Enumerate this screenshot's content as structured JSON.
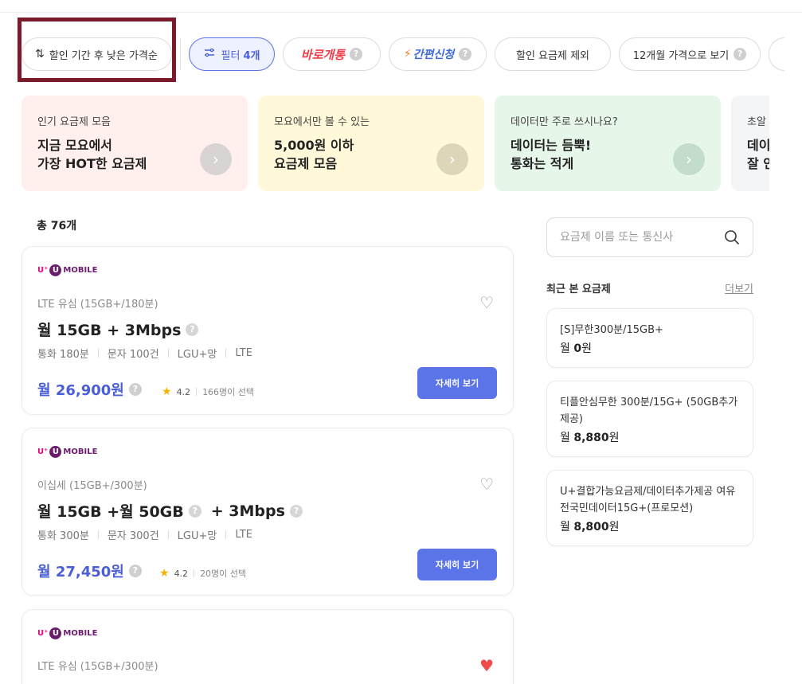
{
  "chips": {
    "sort_label": "할인 기간 후 낮은 가격순",
    "filter_label": "필터",
    "filter_count": "4개",
    "baro_label": "바로개통",
    "easy_label": "간편신청",
    "exclude_discount_label": "할인 요금제 제외",
    "twelve_month_label": "12개월 가격으로 보기",
    "help_symbol": "?"
  },
  "banners": [
    {
      "sub": "인기 요금제 모음",
      "head": "지금 모요에서\n가장 HOT한 요금제"
    },
    {
      "sub": "모요에서만 볼 수 있는",
      "head": "5,000원 이하\n요금제 모음"
    },
    {
      "sub": "데이터만 주로 쓰시나요?",
      "head": "데이터는 듬뿍!\n통화는 적게"
    },
    {
      "sub": "초알",
      "head": "데이\n잘 인"
    }
  ],
  "total_count": "총 76개",
  "plans": [
    {
      "carrier": "MOBILE",
      "category": "LTE 유심 (15GB+/180분)",
      "title_a": "월 15GB + 3Mbps",
      "title_b": "",
      "specs": [
        "통화 180분",
        "문자 100건",
        "LGU+망",
        "LTE"
      ],
      "price": "월 26,900원",
      "rating": "4.2",
      "chosen": "166명이 선택",
      "favorited": false,
      "detail_label": "자세히 보기"
    },
    {
      "carrier": "MOBILE",
      "category": "이십세 (15GB+/300분)",
      "title_a": "월 15GB +월 50GB",
      "title_b": "+ 3Mbps",
      "specs": [
        "통화 300분",
        "문자 300건",
        "LGU+망",
        "LTE"
      ],
      "price": "월 27,450원",
      "rating": "4.2",
      "chosen": "20명이 선택",
      "favorited": false,
      "detail_label": "자세히 보기"
    },
    {
      "carrier": "MOBILE",
      "category": "LTE 유심 (15GB+/300분)",
      "favorited": true
    }
  ],
  "search": {
    "placeholder": "요금제 이름 또는 통신사"
  },
  "recent": {
    "title": "최근 본 요금제",
    "more": "더보기",
    "items": [
      {
        "name": "[S]무한300분/15GB+",
        "price_prefix": "월 ",
        "price_value": "0",
        "price_suffix": "원"
      },
      {
        "name": "티플안심무한 300분/15G+ (50GB추가제공)",
        "price_prefix": "월 ",
        "price_value": "8,880",
        "price_suffix": "원"
      },
      {
        "name": "U+결합가능요금제/데이터추가제공 여유 전국민데이터15G+(프로모션)",
        "price_prefix": "월 ",
        "price_value": "8,800",
        "price_suffix": "원"
      }
    ]
  },
  "colors": {
    "accent": "#5b74e8",
    "price": "#4a5fd6",
    "baro": "#ef3b47",
    "easy": "#3e6ad8",
    "carrier": "#6b1d6b",
    "heart_fav": "#f04a4a",
    "highlight": "#7a1a2a"
  },
  "icons": {
    "sort": "sort-arrows-icon",
    "filter": "sliders-icon",
    "search": "magnifier-icon",
    "heart": "heart-icon",
    "star": "star-icon",
    "arrow": "chevron-right-icon"
  }
}
